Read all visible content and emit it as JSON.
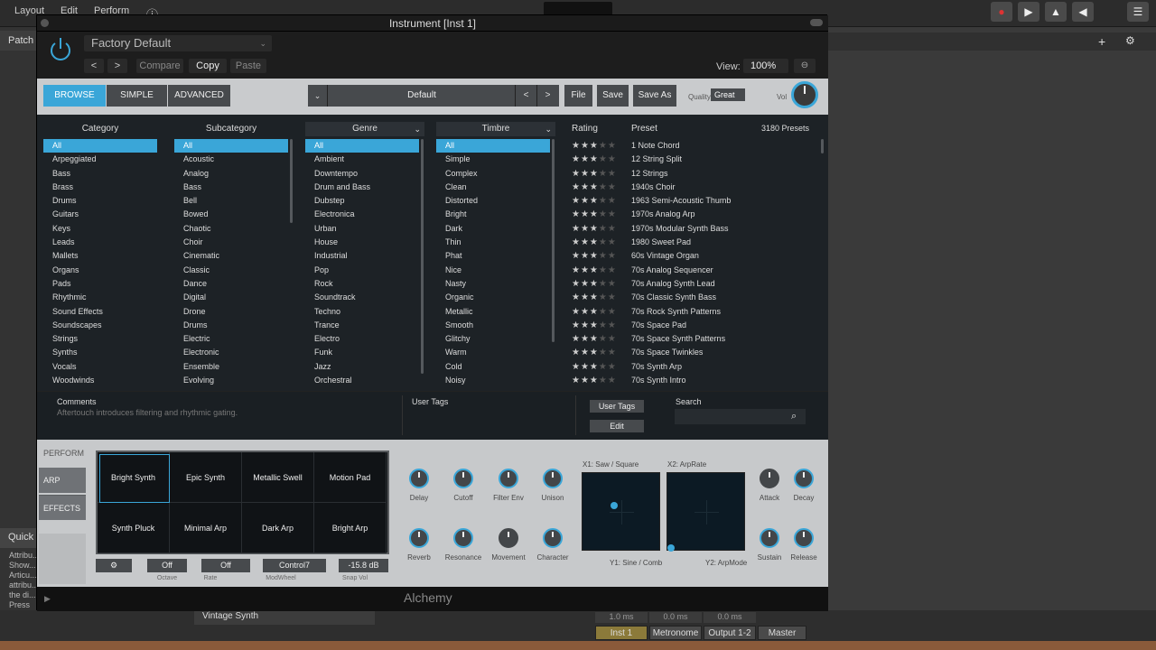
{
  "host": {
    "menu": [
      "Layout",
      "Edit",
      "Perform"
    ],
    "patch_label": "Patch",
    "quick_label": "Quick",
    "quick_text": "Attribu... Show... Articu... attribu... the di... Press ⌘/ for more information.",
    "vintage_label": "Vintage Synth",
    "strips": [
      "Inst 1",
      "Metronome",
      "Output 1-2",
      "Master"
    ],
    "ms_values": [
      "1.0 ms",
      "0.0 ms",
      "0.0 ms"
    ]
  },
  "window": {
    "title": "Instrument [Inst 1]"
  },
  "header": {
    "patch_name": "Factory Default",
    "compare_label": "Compare",
    "copy_label": "Copy",
    "paste_label": "Paste",
    "view_label": "View:",
    "view_value": "100%"
  },
  "toolbar": {
    "tabs": [
      "BROWSE",
      "SIMPLE",
      "ADVANCED"
    ],
    "preset_name": "Default",
    "file_label": "File",
    "save_label": "Save",
    "save_as_label": "Save As",
    "quality_label": "Quality",
    "quality_value": "Great",
    "vol_label": "Vol"
  },
  "browser": {
    "headers": {
      "category": "Category",
      "subcategory": "Subcategory",
      "genre": "Genre",
      "timbre": "Timbre",
      "rating": "Rating",
      "preset": "Preset"
    },
    "preset_count": "3180 Presets",
    "category": [
      "All",
      "Arpeggiated",
      "Bass",
      "Brass",
      "Drums",
      "Guitars",
      "Keys",
      "Leads",
      "Mallets",
      "Organs",
      "Pads",
      "Rhythmic",
      "Sound Effects",
      "Soundscapes",
      "Strings",
      "Synths",
      "Vocals",
      "Woodwinds"
    ],
    "subcategory": [
      "All",
      "Acoustic",
      "Analog",
      "Bass",
      "Bell",
      "Bowed",
      "Chaotic",
      "Choir",
      "Cinematic",
      "Classic",
      "Dance",
      "Digital",
      "Drone",
      "Drums",
      "Electric",
      "Electronic",
      "Ensemble",
      "Evolving"
    ],
    "genre": [
      "All",
      "Ambient",
      "Downtempo",
      "Drum and Bass",
      "Dubstep",
      "Electronica",
      "Urban",
      "House",
      "Industrial",
      "Pop",
      "Rock",
      "Soundtrack",
      "Techno",
      "Trance",
      "Electro",
      "Funk",
      "Jazz",
      "Orchestral"
    ],
    "timbre": [
      "All",
      "Simple",
      "Complex",
      "Clean",
      "Distorted",
      "Bright",
      "Dark",
      "Thin",
      "Phat",
      "Nice",
      "Nasty",
      "Organic",
      "Metallic",
      "Smooth",
      "Glitchy",
      "Warm",
      "Cold",
      "Noisy"
    ],
    "presets": [
      "1 Note Chord",
      "12 String Split",
      "12 Strings",
      "1940s Choir",
      "1963 Semi-Acoustic Thumb",
      "1970s Analog Arp",
      "1970s Modular Synth Bass",
      "1980 Sweet Pad",
      "60s Vintage Organ",
      "70s Analog Sequencer",
      "70s Analog Synth Lead",
      "70s Classic Synth Bass",
      "70s Rock Synth Patterns",
      "70s Space Pad",
      "70s Space Synth Patterns",
      "70s Space Twinkles",
      "70s Synth Arp",
      "70s Synth Intro"
    ],
    "rating_stars": "★★★★★"
  },
  "comments": {
    "label": "Comments",
    "text": "Aftertouch introduces filtering and rhythmic gating.",
    "user_tags_label": "User Tags",
    "user_tags_button": "User Tags",
    "edit_button": "Edit",
    "search_label": "Search",
    "search_value": ""
  },
  "perform": {
    "label": "PERFORM",
    "side_tabs": [
      "ARP",
      "EFFECTS"
    ],
    "pads": [
      "Bright Synth",
      "Epic Synth",
      "Metallic Swell",
      "Motion Pad",
      "Synth Pluck",
      "Minimal Arp",
      "Dark Arp",
      "Bright Arp"
    ],
    "controls": {
      "octave_value": "Off",
      "octave_label": "Octave",
      "rate_value": "Off",
      "rate_label": "Rate",
      "modwheel_value": "Control7",
      "modwheel_label": "ModWheel",
      "snapvol_value": "-15.8 dB",
      "snapvol_label": "Snap Vol"
    },
    "knobs_top": [
      "Delay",
      "Cutoff",
      "Filter Env",
      "Unison"
    ],
    "knobs_bottom": [
      "Reverb",
      "Resonance",
      "Movement",
      "Character"
    ],
    "xy1_top": "X1: Saw / Square",
    "xy1_bottom": "Y1: Sine / Comb",
    "xy2_top": "X2: ArpRate",
    "xy2_bottom": "Y2: ArpMode",
    "env_top": [
      "Attack",
      "Decay"
    ],
    "env_bottom": [
      "Sustain",
      "Release"
    ]
  },
  "footer": {
    "brand": "Alchemy"
  },
  "colors": {
    "accent": "#3aa6d8",
    "panel": "#c9cbcd",
    "browser_bg": "#1d2226"
  }
}
